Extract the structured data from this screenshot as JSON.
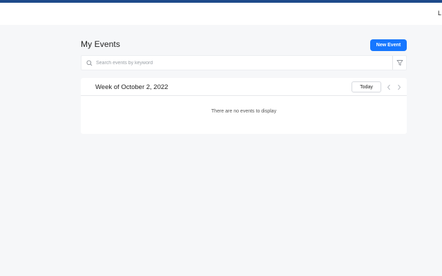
{
  "topbar": {
    "truncated_text": "L"
  },
  "page": {
    "title": "My Events",
    "new_event_label": "New Event"
  },
  "search": {
    "placeholder": "Search events by keyword",
    "value": ""
  },
  "calendar": {
    "week_label": "Week of October 2, 2022",
    "today_label": "Today",
    "empty_message": "There are no events to display"
  },
  "icons": {
    "search": "search-icon",
    "filter": "filter-icon",
    "prev": "chevron-left-icon",
    "next": "chevron-right-icon"
  },
  "colors": {
    "accent_bar": "#1e4a8a",
    "primary_button": "#1677ff",
    "page_background": "#f6f7f9"
  }
}
